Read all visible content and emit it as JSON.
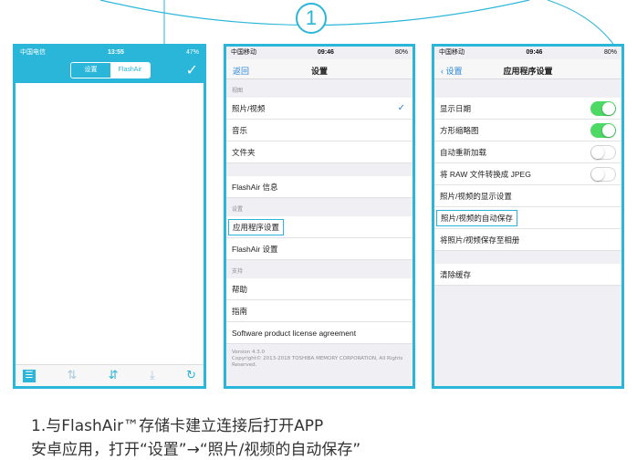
{
  "step_number": "1",
  "phone1": {
    "status": {
      "carrier": "中国电信",
      "time": "13:55",
      "battery": "47%"
    },
    "tabs": [
      "设置",
      "FlashAir"
    ],
    "confirm_icon": "checkmark-icon",
    "toolbar_icons": [
      "menu-icon",
      "sort-icon",
      "filter-icon",
      "download-icon",
      "refresh-icon"
    ]
  },
  "phone2": {
    "status": {
      "carrier": "中国移动",
      "time": "09:46",
      "battery": "80%"
    },
    "nav": {
      "back": "返回",
      "title": "设置"
    },
    "section_view": "视图",
    "view_items": [
      "照片/视频",
      "音乐",
      "文件夹"
    ],
    "flashair_info": "FlashAir 信息",
    "section_settings": "设置",
    "settings_items": [
      "应用程序设置",
      "FlashAir 设置"
    ],
    "section_support": "支持",
    "support_items": [
      "帮助",
      "指南",
      "Software product license agreement"
    ],
    "version": "Version 4.3.0",
    "copyright": "Copyright© 2013-2018 TOSHIBA MEMORY CORPORATION, All Rights Reserved."
  },
  "phone3": {
    "status": {
      "carrier": "中国移动",
      "time": "09:46",
      "battery": "80%"
    },
    "nav": {
      "back": "设置",
      "title": "应用程序设置"
    },
    "toggles": [
      {
        "label": "显示日期",
        "on": true
      },
      {
        "label": "方形缩略图",
        "on": true
      },
      {
        "label": "自动重新加载",
        "on": false
      },
      {
        "label": "将 RAW 文件转换成 JPEG",
        "on": false
      }
    ],
    "links": [
      "照片/视频的显示设置",
      "照片/视频的自动保存",
      "将照片/视频保存至相册"
    ],
    "clear_cache": "清除缓存"
  },
  "caption": {
    "line1": "1.与FlashAir™存储卡建立连接后打开APP",
    "line2": "安卓应用，打开“设置”→“照片/视频的自动保存”"
  },
  "colors": {
    "accent": "#2ab6d9",
    "toggle_on": "#4cd964",
    "link_blue": "#2a86d9"
  }
}
